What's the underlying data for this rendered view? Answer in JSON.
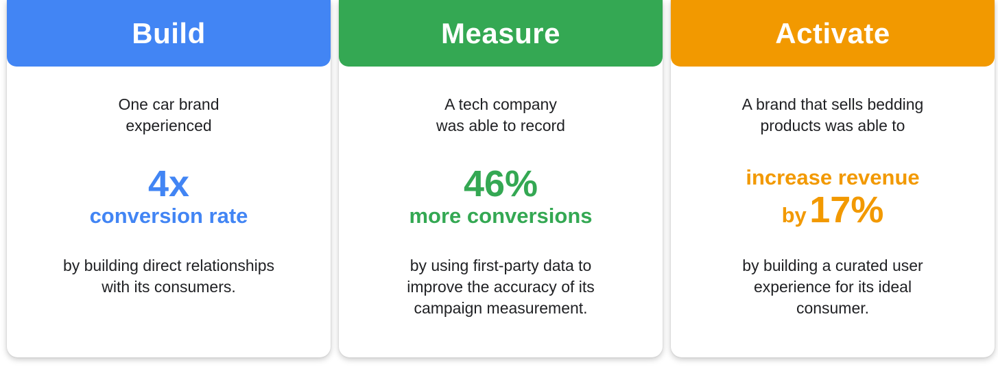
{
  "colors": {
    "build": "#4285f4",
    "measure": "#34a853",
    "activate": "#f29900"
  },
  "cards": {
    "build": {
      "title": "Build",
      "intro_line1": "One car brand",
      "intro_line2": "experienced",
      "stat_big": "4x",
      "stat_sub": "conversion rate",
      "outro_line1": "by building direct relationships",
      "outro_line2": "with its consumers."
    },
    "measure": {
      "title": "Measure",
      "intro_line1": "A tech company",
      "intro_line2": "was able to record",
      "stat_big": "46%",
      "stat_sub": "more conversions",
      "outro_line1": "by using first-party data to",
      "outro_line2": "improve the accuracy of its",
      "outro_line3": "campaign measurement."
    },
    "activate": {
      "title": "Activate",
      "intro_line1": "A brand that sells bedding",
      "intro_line2": "products was able to",
      "stat_line1": "increase revenue",
      "stat_by": "by",
      "stat_big": "17%",
      "outro_line1": "by building a curated user",
      "outro_line2": "experience for its ideal",
      "outro_line3": "consumer."
    }
  }
}
